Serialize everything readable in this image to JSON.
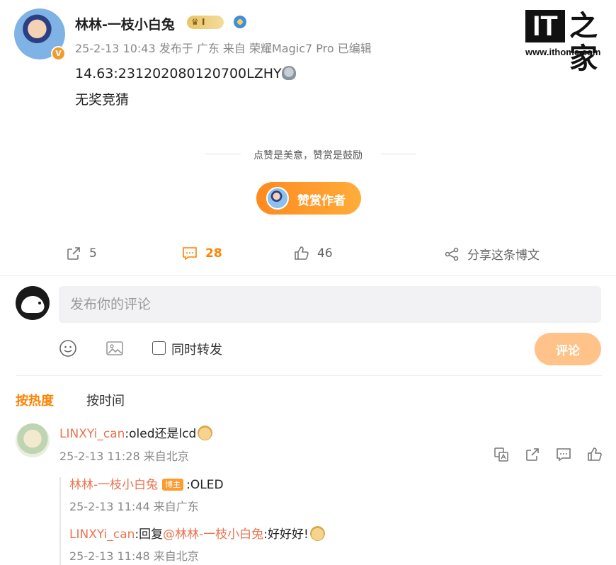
{
  "post": {
    "author": "林林-一枝小白兔",
    "vip_badge": "I",
    "meta": "25-2-13 10:43 发布于 广东 来自 荣耀Magic7 Pro 已编辑",
    "content_line1": "14.63:231202080120700LZHY",
    "content_line2": "无奖竞猜"
  },
  "logo": {
    "mark": "IT",
    "han": "之家",
    "url": "www.ithome.com"
  },
  "tip": {
    "divider": "点赞是美意，赞赏是鼓励",
    "button": "赞赏作者"
  },
  "actions": {
    "repost_count": "5",
    "comment_count": "28",
    "like_count": "46",
    "share_label": "分享这条博文"
  },
  "composer": {
    "placeholder": "发布你的评论",
    "forward_label": "同时转发",
    "submit_label": "评论"
  },
  "sort": {
    "hot": "按热度",
    "time": "按时间"
  },
  "comment": {
    "user": "LINXYi_can",
    "text": ":oled还是lcd",
    "meta": "25-2-13 11:28 来自北京",
    "replies": [
      {
        "user": "林林-一枝小白兔",
        "tag": "博主",
        "text": ":OLED",
        "meta": "25-2-13 11:44 来自广东"
      },
      {
        "user": "LINXYi_can",
        "prefix": ":回复",
        "mention": "@林林-一枝小白兔",
        "text": ":好好好!",
        "meta": "25-2-13 11:48 来自北京"
      }
    ]
  },
  "colors": {
    "accent": "#ff8200",
    "username": "#eb7350",
    "tip_gradient_start": "#ff8a1f",
    "submit_disabled": "#ffc389"
  }
}
